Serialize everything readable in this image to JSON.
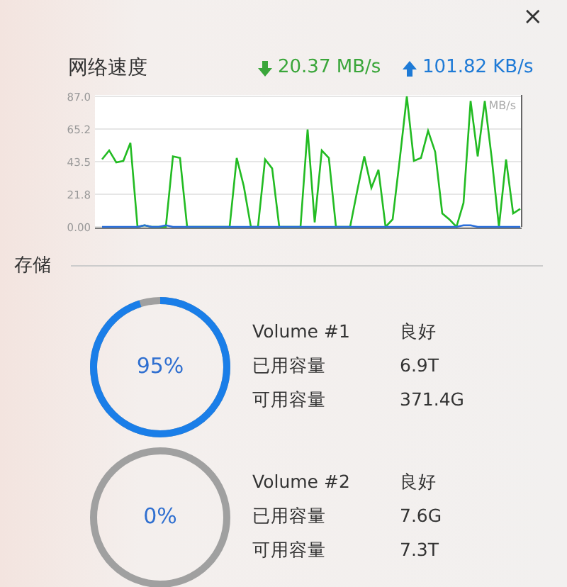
{
  "close_button": "×",
  "network": {
    "label": "网络速度",
    "download": "20.37 MB/s",
    "upload": "101.82 KB/s",
    "chart_data": {
      "type": "line",
      "grid": true,
      "ylabel": "MB/s",
      "ylim": [
        0,
        87
      ],
      "yticks": [
        {
          "value": 0,
          "label": "0.00"
        },
        {
          "value": 21.8,
          "label": "21.8"
        },
        {
          "value": 43.5,
          "label": "43.5"
        },
        {
          "value": 65.2,
          "label": "65.2"
        },
        {
          "value": 87,
          "label": "87.0"
        }
      ],
      "series": [
        {
          "color": "#22bb22",
          "values": [
            45,
            51,
            43,
            44,
            56,
            0,
            1,
            0,
            0,
            0,
            47,
            46,
            0,
            0,
            0,
            0,
            0,
            0,
            0,
            46,
            27,
            0,
            0,
            45,
            39,
            0,
            0,
            0,
            0,
            65,
            3,
            51,
            46,
            0,
            0,
            0,
            24,
            47,
            26,
            38,
            0,
            5,
            45,
            87,
            44,
            46,
            64,
            50,
            9,
            5,
            0,
            16,
            84,
            47,
            84,
            45,
            0,
            45,
            9,
            12
          ]
        },
        {
          "color": "#2a6fdb",
          "values": [
            0,
            0,
            0,
            0,
            0,
            0,
            1,
            0,
            0,
            1,
            0,
            0,
            0,
            0,
            0,
            0,
            0,
            0,
            0,
            0,
            0,
            0,
            0,
            0,
            0,
            0,
            0,
            0,
            0,
            0,
            0,
            0,
            0,
            0,
            0,
            0,
            0,
            0,
            0,
            0,
            0,
            0,
            0,
            0,
            0,
            0,
            0,
            0,
            0,
            0,
            0,
            1,
            1,
            0,
            0,
            0,
            0,
            0,
            0,
            0
          ]
        }
      ]
    }
  },
  "storage": {
    "title": "存储",
    "volumes": [
      {
        "percent": "95%",
        "level": 0.95,
        "name": "Volume #1",
        "status": "良好",
        "used_label": "已用容量",
        "used": "6.9T",
        "free_label": "可用容量",
        "free": "371.4G"
      },
      {
        "percent": "0%",
        "level": 0,
        "name": "Volume #2",
        "status": "良好",
        "used_label": "已用容量",
        "used": "7.6G",
        "free_label": "可用容量",
        "free": "7.3T"
      }
    ]
  }
}
